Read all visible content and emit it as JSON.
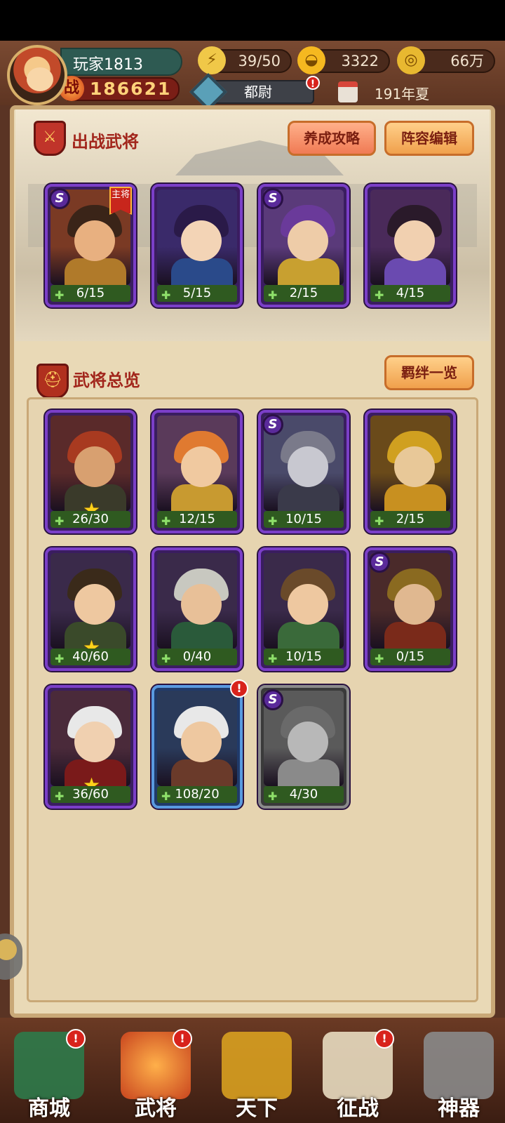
{
  "player": {
    "name": "玩家1813",
    "power_label": "战",
    "power": "186621",
    "rank": "都尉",
    "season": "191年夏"
  },
  "resources": [
    {
      "name": "stamina",
      "value": "39/50",
      "icon": "lightning-plus-icon"
    },
    {
      "name": "gold-ingot",
      "value": "3322",
      "icon": "gold-ingot-plus-icon"
    },
    {
      "name": "coins",
      "value": "66万",
      "icon": "coin-plus-icon"
    }
  ],
  "battle_section": {
    "title": "出战武将",
    "guide_button": "养成攻略",
    "edit_button": "阵容编辑"
  },
  "overview_section": {
    "title": "武将总览",
    "bonds_button": "羁绊一览"
  },
  "leader_badge": "主将",
  "battle_heroes": [
    {
      "progress": "6/15",
      "s_rank": true,
      "leader": true
    },
    {
      "progress": "5/15",
      "s_rank": false
    },
    {
      "progress": "2/15",
      "s_rank": true
    },
    {
      "progress": "4/15",
      "s_rank": false
    }
  ],
  "all_heroes": [
    {
      "progress": "26/30",
      "s_rank": false,
      "star": true
    },
    {
      "progress": "12/15",
      "s_rank": false
    },
    {
      "progress": "10/15",
      "s_rank": true
    },
    {
      "progress": "2/15",
      "s_rank": false
    },
    {
      "progress": "40/60",
      "s_rank": false,
      "star": true
    },
    {
      "progress": "0/40",
      "s_rank": false
    },
    {
      "progress": "10/15",
      "s_rank": false
    },
    {
      "progress": "0/15",
      "s_rank": true
    },
    {
      "progress": "36/60",
      "s_rank": false,
      "star": true
    },
    {
      "progress": "108/20",
      "s_rank": false,
      "alert": true,
      "frame": "blue"
    },
    {
      "progress": "4/30",
      "s_rank": true,
      "locked": true
    }
  ],
  "s_badge": "S",
  "star_glyph": "★",
  "alert_glyph": "!",
  "nav": [
    {
      "label": "商城",
      "alert": true,
      "color": "#2e7a4a"
    },
    {
      "label": "武将",
      "alert": true,
      "active": true,
      "color": "#c8441e"
    },
    {
      "label": "天下",
      "alert": false,
      "color": "#d8a020"
    },
    {
      "label": "征战",
      "alert": true,
      "color": "#e8dcc0"
    },
    {
      "label": "神器",
      "alert": false,
      "color": "#8a8a8a"
    }
  ]
}
